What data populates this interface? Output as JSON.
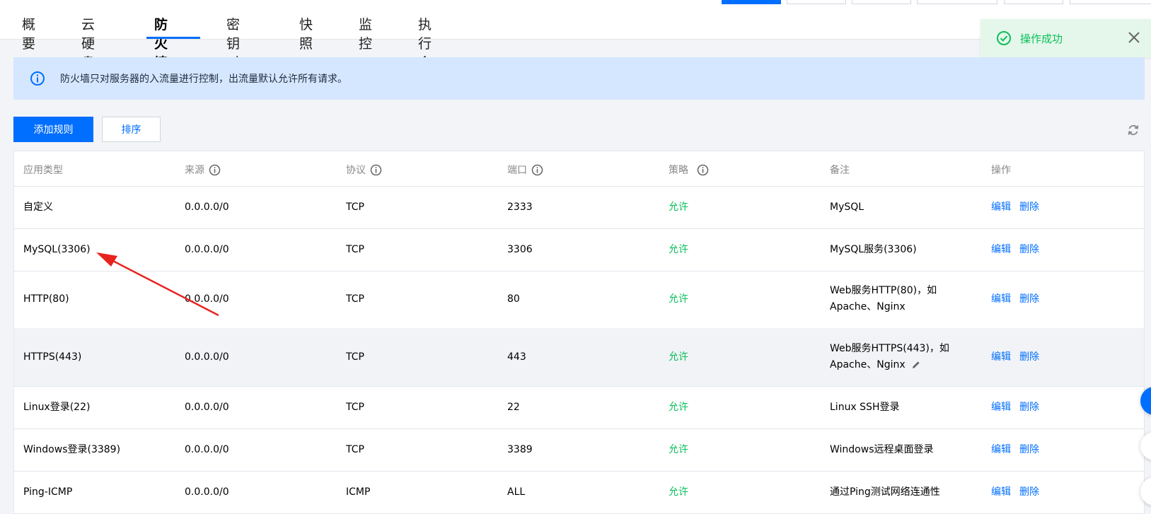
{
  "tabs": [
    "概要",
    "云硬盘",
    "防火墙",
    "密钥对",
    "快照",
    "监控",
    "执行命令"
  ],
  "active_tab": "防火墙",
  "toast": {
    "message": "操作成功"
  },
  "notice": {
    "text": "防火墙只对服务器的入流量进行控制，出流量默认允许所有请求。"
  },
  "toolbar": {
    "add_rule_label": "添加规则",
    "sort_label": "排序"
  },
  "table": {
    "columns": [
      "应用类型",
      "来源",
      "协议",
      "端口",
      "策略",
      "备注",
      "操作"
    ],
    "rows": [
      {
        "app": "自定义",
        "source": "0.0.0.0/0",
        "protocol": "TCP",
        "port": "2333",
        "policy": "允许",
        "remark": "MySQL"
      },
      {
        "app": "MySQL(3306)",
        "source": "0.0.0.0/0",
        "protocol": "TCP",
        "port": "3306",
        "policy": "允许",
        "remark": "MySQL服务(3306)"
      },
      {
        "app": "HTTP(80)",
        "source": "0.0.0.0/0",
        "protocol": "TCP",
        "port": "80",
        "policy": "允许",
        "remark": "Web服务HTTP(80)，如",
        "remark2": "Apache、Nginx"
      },
      {
        "app": "HTTPS(443)",
        "source": "0.0.0.0/0",
        "protocol": "TCP",
        "port": "443",
        "policy": "允许",
        "remark": "Web服务HTTPS(443)，如",
        "remark2": "Apache、Nginx"
      },
      {
        "app": "Linux登录(22)",
        "source": "0.0.0.0/0",
        "protocol": "TCP",
        "port": "22",
        "policy": "允许",
        "remark": "Linux SSH登录"
      },
      {
        "app": "Windows登录(3389)",
        "source": "0.0.0.0/0",
        "protocol": "TCP",
        "port": "3389",
        "policy": "允许",
        "remark": "Windows远程桌面登录"
      },
      {
        "app": "Ping-ICMP",
        "source": "0.0.0.0/0",
        "protocol": "ICMP",
        "port": "ALL",
        "policy": "允许",
        "remark": "通过Ping测试网络连通性"
      }
    ],
    "action_edit": "编辑",
    "action_delete": "删除"
  },
  "colors": {
    "primary": "#006eff",
    "success": "#0abf5b",
    "notice_bg": "#d5e7ff",
    "arrow": "#e8231f"
  }
}
